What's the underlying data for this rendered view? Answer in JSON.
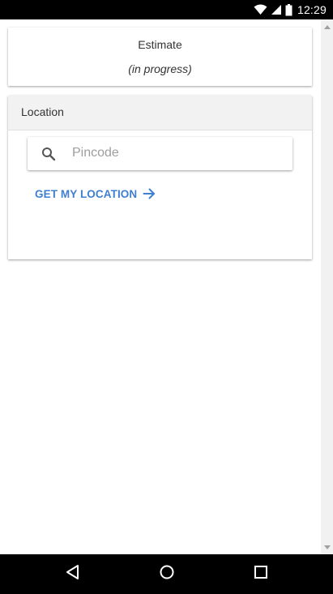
{
  "status_bar": {
    "time": "12:29",
    "icons": [
      "wifi-icon",
      "cell-signal-icon",
      "battery-icon"
    ]
  },
  "estimate_card": {
    "title": "Estimate",
    "status": "(in progress)"
  },
  "location_card": {
    "title": "Location",
    "search": {
      "placeholder": "Pincode",
      "value": "",
      "icon": "search-icon"
    },
    "geo_link": {
      "label": "GET MY LOCATION",
      "icon": "arrow-right-icon"
    }
  },
  "nav_bar": {
    "buttons": [
      "back-icon",
      "home-icon",
      "recents-icon"
    ]
  },
  "colors": {
    "accent": "#3f7fd0",
    "status_bar_bg": "#000000",
    "nav_bar_bg": "#000000",
    "card_header_bg": "#f2f2f2",
    "placeholder": "#9e9e9e"
  }
}
